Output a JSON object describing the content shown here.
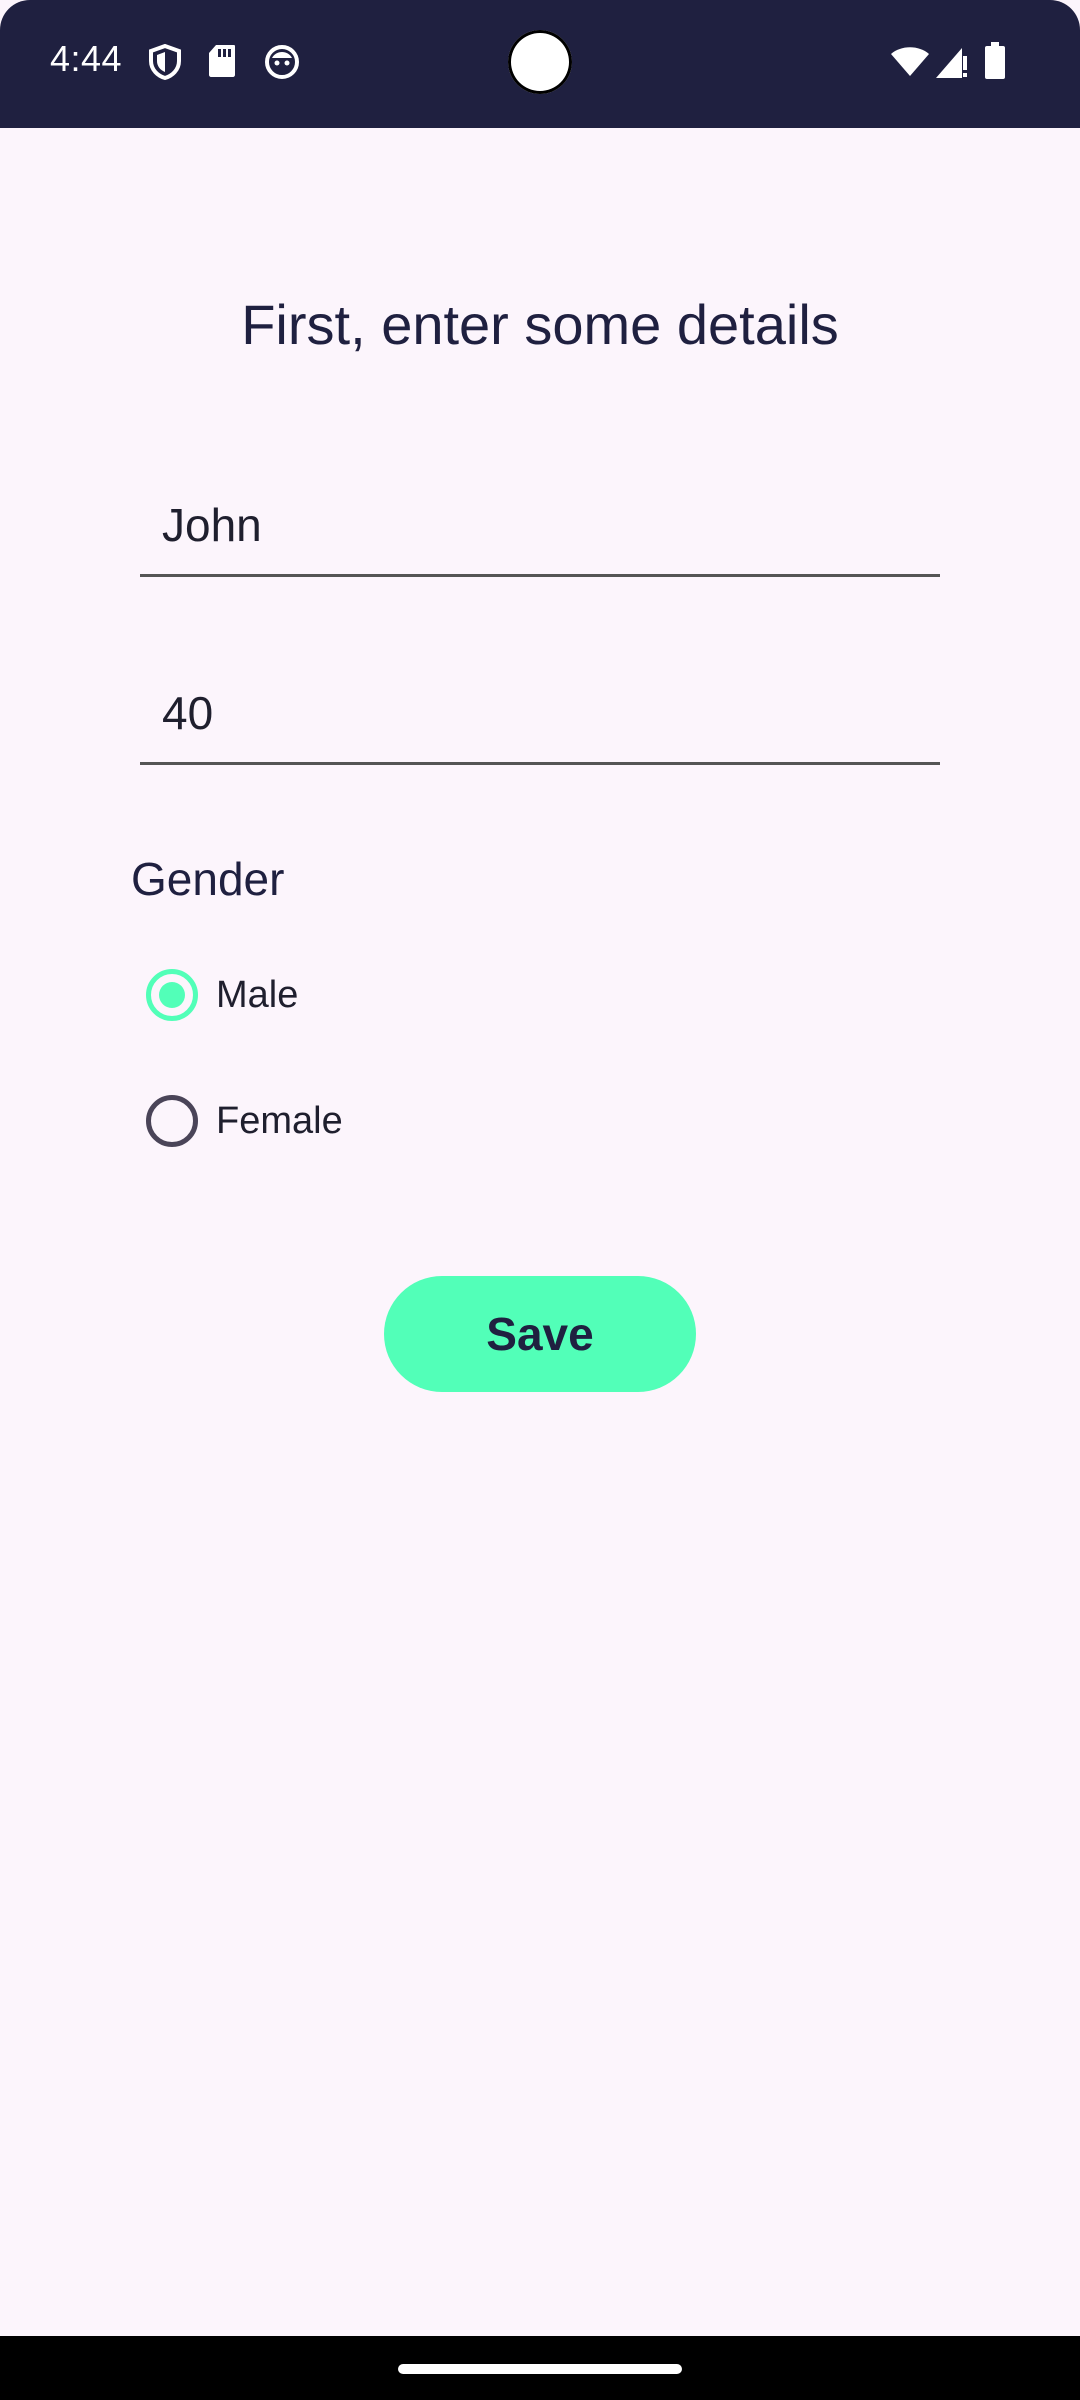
{
  "status_bar": {
    "time": "4:44",
    "left_icons": [
      "shield-icon",
      "sd-card-icon",
      "face-icon"
    ],
    "right_icons": [
      "wifi-icon",
      "signal-alert-icon",
      "battery-icon"
    ]
  },
  "page": {
    "title": "First, enter some details"
  },
  "form": {
    "name_value": "John",
    "age_value": "40",
    "gender_label": "Gender",
    "gender_options": [
      {
        "label": "Male",
        "selected": true
      },
      {
        "label": "Female",
        "selected": false
      }
    ],
    "save_label": "Save"
  },
  "colors": {
    "accent": "#52ffb8",
    "status_bar": "#1f2040",
    "background": "#fcf5fc",
    "text": "#1f2040"
  }
}
